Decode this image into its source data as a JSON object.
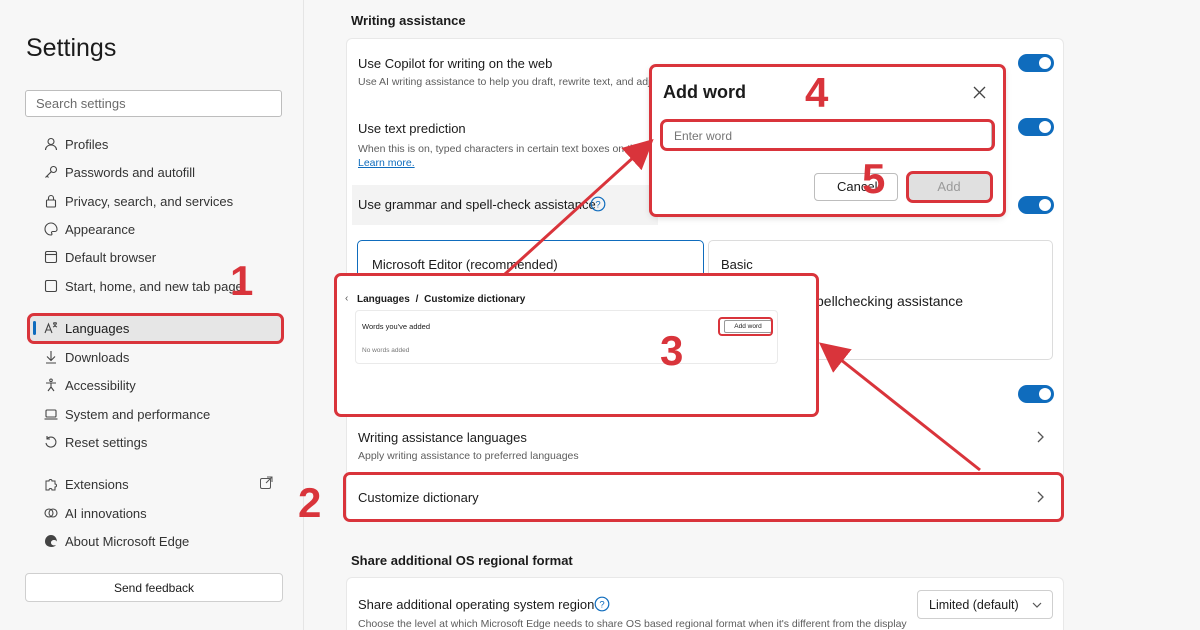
{
  "sidebar": {
    "title": "Settings",
    "search_placeholder": "Search settings",
    "items": [
      {
        "label": "Profiles",
        "icon": "person-icon"
      },
      {
        "label": "Passwords and autofill",
        "icon": "key-icon"
      },
      {
        "label": "Privacy, search, and services",
        "icon": "lock-icon"
      },
      {
        "label": "Appearance",
        "icon": "palette-icon"
      },
      {
        "label": "Default browser",
        "icon": "browser-icon"
      },
      {
        "label": "Start, home, and new tab page",
        "icon": "home-icon"
      },
      {
        "label": "Languages",
        "icon": "language-icon",
        "active": true
      },
      {
        "label": "Downloads",
        "icon": "download-icon"
      },
      {
        "label": "Accessibility",
        "icon": "accessibility-icon"
      },
      {
        "label": "System and performance",
        "icon": "laptop-icon"
      },
      {
        "label": "Reset settings",
        "icon": "reset-icon"
      },
      {
        "label": "Extensions",
        "icon": "puzzle-icon"
      },
      {
        "label": "AI innovations",
        "icon": "sparkle-icon"
      },
      {
        "label": "About Microsoft Edge",
        "icon": "edge-icon"
      }
    ],
    "feedback_label": "Send feedback"
  },
  "main": {
    "section_writing": "Writing assistance",
    "copilot_title": "Use Copilot for writing on the web",
    "copilot_desc": "Use AI writing assistance to help you draft, rewrite text, and adj",
    "prediction_title": "Use text prediction",
    "prediction_desc": "When this is on, typed characters in certain text boxes on th",
    "learn_more": "Learn more.",
    "grammar_title": "Use grammar and spell-check assistance",
    "option_editor": "Microsoft Editor (recommended)",
    "option_basic": "Basic",
    "basic_desc_partial": "pellchecking assistance",
    "wa_languages_title": "Writing assistance languages",
    "wa_languages_desc": "Apply writing assistance to preferred languages",
    "customize_dictionary": "Customize dictionary",
    "section_share": "Share additional OS regional format",
    "share_title": "Share additional operating system region",
    "share_desc": "Choose the level at which Microsoft Edge needs to share OS based regional format when it's different from the display",
    "share_select": "Limited (default)"
  },
  "inset": {
    "breadcrumb_parent": "Languages",
    "breadcrumb_sep": "/",
    "breadcrumb_current": "Customize dictionary",
    "words_added": "Words you've added",
    "add_word_btn": "Add word",
    "no_words": "No words added"
  },
  "dialog": {
    "title": "Add word",
    "input_placeholder": "Enter word",
    "cancel_label": "Cancel",
    "add_label": "Add"
  },
  "annotations": {
    "step1": "1",
    "step2": "2",
    "step3": "3",
    "step4": "4",
    "step5": "5",
    "color": "#d9343b"
  },
  "colors": {
    "accent": "#0f6cbd",
    "annotation": "#d9343b"
  }
}
